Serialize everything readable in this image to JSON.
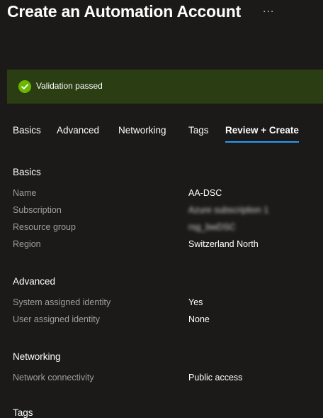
{
  "header": {
    "title": "Create an Automation Account",
    "more_icon": "ellipsis-icon",
    "more_label": "···"
  },
  "banner": {
    "icon": "check-circle-icon",
    "message": "Validation passed",
    "color": "#2a3d13",
    "icon_color": "#6bb700"
  },
  "tabs": [
    {
      "label": "Basics"
    },
    {
      "label": "Advanced"
    },
    {
      "label": "Networking"
    },
    {
      "label": "Tags"
    },
    {
      "label": "Review + Create",
      "active": true
    }
  ],
  "accent_color": "#2899f5",
  "sections": {
    "basics": {
      "title": "Basics",
      "rows": [
        {
          "label": "Name",
          "value": "AA-DSC"
        },
        {
          "label": "Subscription",
          "value": "Azure subscription 1"
        },
        {
          "label": "Resource group",
          "value": "rsg_bwDSC"
        },
        {
          "label": "Region",
          "value": "Switzerland North"
        }
      ]
    },
    "advanced": {
      "title": "Advanced",
      "rows": [
        {
          "label": "System assigned identity",
          "value": "Yes"
        },
        {
          "label": "User assigned identity",
          "value": "None"
        }
      ]
    },
    "networking": {
      "title": "Networking",
      "rows": [
        {
          "label": "Network connectivity",
          "value": "Public access"
        }
      ]
    },
    "tags": {
      "title": "Tags"
    }
  }
}
